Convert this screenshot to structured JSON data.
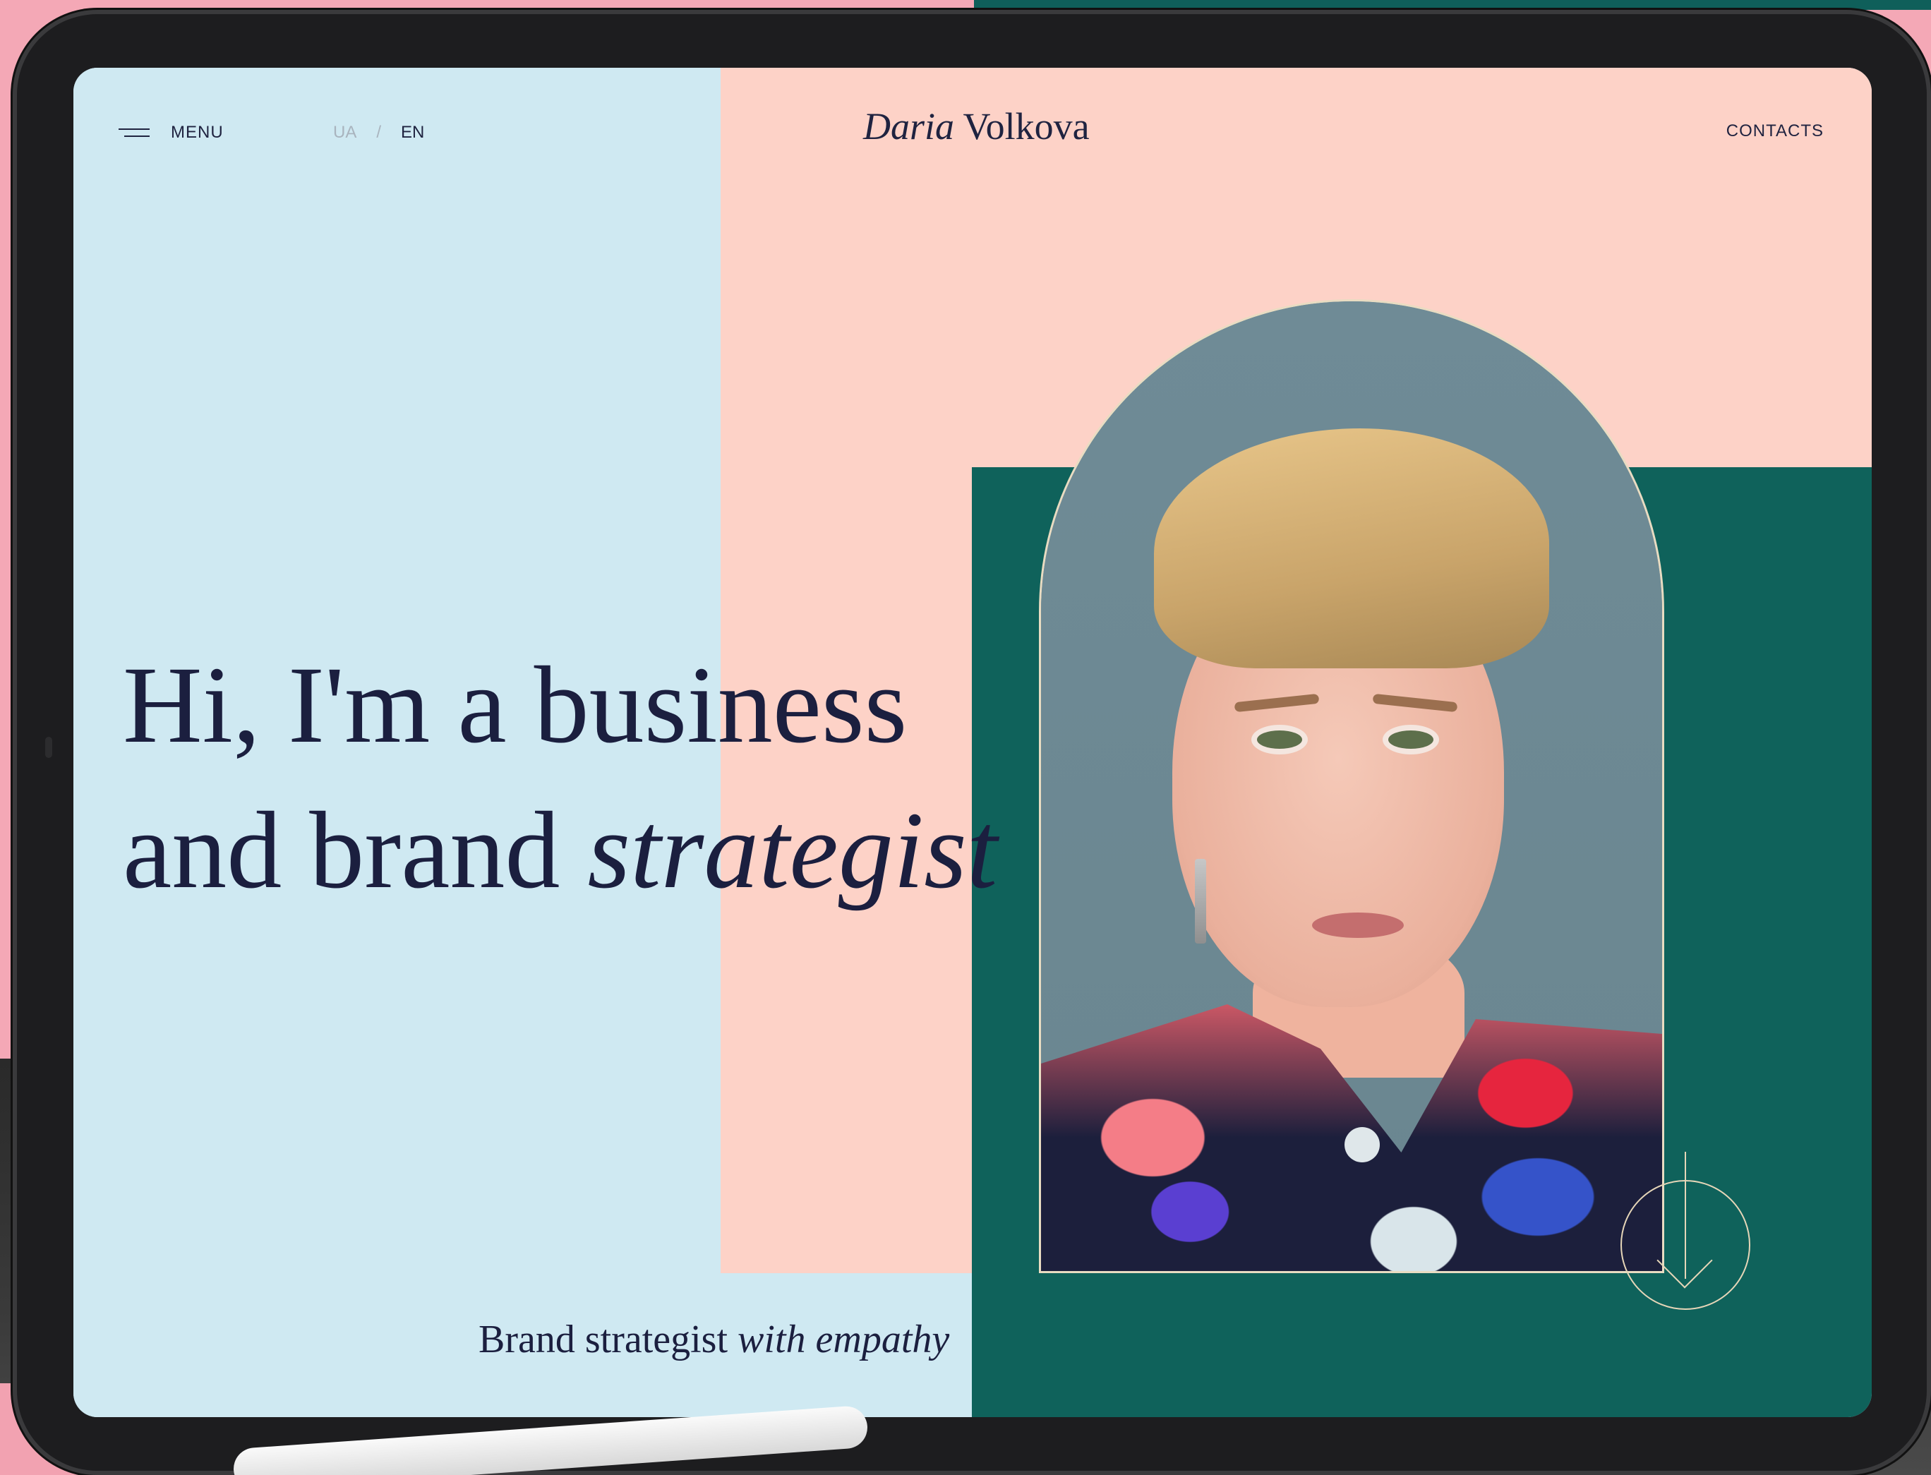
{
  "header": {
    "menu_label": "MENU",
    "lang_ua": "UA",
    "lang_separator": "/",
    "lang_en": "EN",
    "logo_first": "Daria",
    "logo_last": "Volkova",
    "contacts_label": "CONTACTS"
  },
  "hero": {
    "line1": "Hi, I'm a business",
    "line2_plain": "and brand",
    "line2_italic": "strategist"
  },
  "tagline": {
    "plain": "Brand strategist",
    "italic": "with empathy"
  },
  "icons": {
    "menu": "hamburger-icon",
    "scroll": "arrow-down-icon"
  },
  "colors": {
    "panel_blue": "#cfe9f2",
    "panel_pink": "#fdd2c7",
    "panel_teal": "#0f625b",
    "text_navy": "#1b1f3f",
    "accent_gold": "#e6d6b8",
    "lang_inactive": "#a9b4be"
  }
}
